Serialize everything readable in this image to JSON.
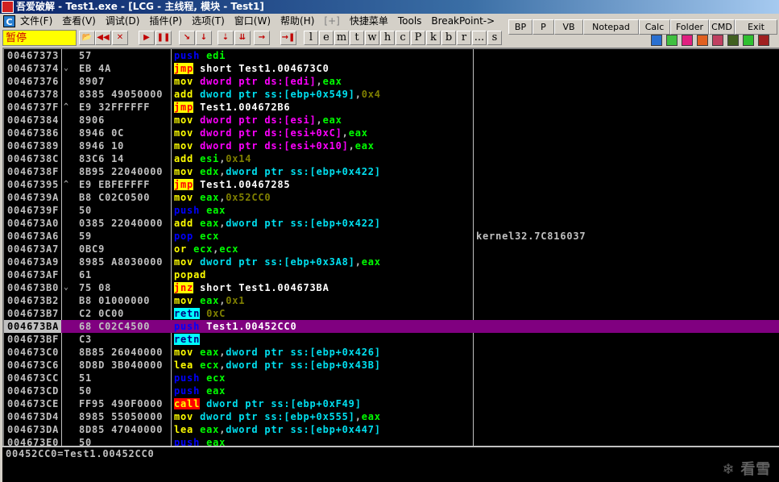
{
  "title": "吾爱破解 - Test1.exe - [LCG - 主线程, 模块 - Test1]",
  "menu": [
    "文件(F)",
    "查看(V)",
    "调试(D)",
    "插件(P)",
    "选项(T)",
    "窗口(W)",
    "帮助(H)",
    "[+]",
    "快捷菜单",
    "Tools",
    "BreakPoint->"
  ],
  "status": "暂停",
  "toolbar": {
    "icon_buttons": [
      "open-icon",
      "rewind-icon",
      "close-icon",
      "run-icon",
      "pause-icon",
      "step-into-icon",
      "step-over-icon",
      "trace-into-icon",
      "trace-over-icon",
      "execute-till-return-icon",
      "go-to-icon"
    ],
    "letter_buttons": [
      "l",
      "e",
      "m",
      "t",
      "w",
      "h",
      "c",
      "P",
      "k",
      "b",
      "r",
      "...",
      "s"
    ],
    "right_buttons": [
      "BP",
      "P",
      "VB",
      "Notepad",
      "Calc",
      "Folder",
      "CMD",
      "Exit"
    ]
  },
  "rows": [
    {
      "addr": "00467373",
      "mark": "",
      "hex": "57",
      "dis": [
        [
          "push",
          "push"
        ],
        [
          " ",
          "p"
        ],
        [
          "edi",
          "reg"
        ]
      ]
    },
    {
      "addr": "00467374",
      "mark": "⌄",
      "hex": "EB 4A",
      "dis": [
        [
          "jmp",
          "jmp"
        ],
        [
          " short Test1.004673C0",
          "label"
        ]
      ]
    },
    {
      "addr": "00467376",
      "mark": "",
      "hex": "8907",
      "dis": [
        [
          "mov",
          "op"
        ],
        [
          " dword ptr ds:[edi]",
          "ds"
        ],
        [
          ",",
          "p"
        ],
        [
          "eax",
          "reg"
        ]
      ]
    },
    {
      "addr": "00467378",
      "mark": "",
      "hex": "8385 49050000",
      "dis": [
        [
          "add",
          "op"
        ],
        [
          " dword ptr ss:[ebp+0x549]",
          "ss"
        ],
        [
          ",",
          "p"
        ],
        [
          "0x4",
          "const"
        ]
      ]
    },
    {
      "addr": "0046737F",
      "mark": "^",
      "hex": "E9 32FFFFFF",
      "dis": [
        [
          "jmp",
          "jmp"
        ],
        [
          " Test1.004672B6",
          "label"
        ]
      ]
    },
    {
      "addr": "00467384",
      "mark": "",
      "hex": "8906",
      "dis": [
        [
          "mov",
          "op"
        ],
        [
          " dword ptr ds:[esi]",
          "ds"
        ],
        [
          ",",
          "p"
        ],
        [
          "eax",
          "reg"
        ]
      ]
    },
    {
      "addr": "00467386",
      "mark": "",
      "hex": "8946 0C",
      "dis": [
        [
          "mov",
          "op"
        ],
        [
          " dword ptr ds:[esi+0xC]",
          "ds"
        ],
        [
          ",",
          "p"
        ],
        [
          "eax",
          "reg"
        ]
      ]
    },
    {
      "addr": "00467389",
      "mark": "",
      "hex": "8946 10",
      "dis": [
        [
          "mov",
          "op"
        ],
        [
          " dword ptr ds:[esi+0x10]",
          "ds"
        ],
        [
          ",",
          "p"
        ],
        [
          "eax",
          "reg"
        ]
      ]
    },
    {
      "addr": "0046738C",
      "mark": "",
      "hex": "83C6 14",
      "dis": [
        [
          "add",
          "op"
        ],
        [
          " esi",
          "reg"
        ],
        [
          ",",
          "p"
        ],
        [
          "0x14",
          "const"
        ]
      ]
    },
    {
      "addr": "0046738F",
      "mark": "",
      "hex": "8B95 22040000",
      "dis": [
        [
          "mov",
          "op"
        ],
        [
          " edx",
          "reg"
        ],
        [
          ",",
          "p"
        ],
        [
          "dword ptr ss:[ebp+0x422]",
          "ss"
        ]
      ]
    },
    {
      "addr": "00467395",
      "mark": "^",
      "hex": "E9 EBFEFFFF",
      "dis": [
        [
          "jmp",
          "jmp"
        ],
        [
          " Test1.00467285",
          "label"
        ]
      ]
    },
    {
      "addr": "0046739A",
      "mark": "",
      "hex": "B8 C02C0500",
      "dis": [
        [
          "mov",
          "op"
        ],
        [
          " eax",
          "reg"
        ],
        [
          ",",
          "p"
        ],
        [
          "0x52CC0",
          "const"
        ]
      ]
    },
    {
      "addr": "0046739F",
      "mark": "",
      "hex": "50",
      "dis": [
        [
          "push",
          "push"
        ],
        [
          " eax",
          "reg"
        ]
      ]
    },
    {
      "addr": "004673A0",
      "mark": "",
      "hex": "0385 22040000",
      "dis": [
        [
          "add",
          "op"
        ],
        [
          " eax",
          "reg"
        ],
        [
          ",",
          "p"
        ],
        [
          "dword ptr ss:[ebp+0x422]",
          "ss"
        ]
      ]
    },
    {
      "addr": "004673A6",
      "mark": "",
      "hex": "59",
      "dis": [
        [
          "pop",
          "push"
        ],
        [
          " ecx",
          "reg"
        ]
      ],
      "comment": "kernel32.7C816037"
    },
    {
      "addr": "004673A7",
      "mark": "",
      "hex": "0BC9",
      "dis": [
        [
          "or",
          "op"
        ],
        [
          " ecx",
          "reg"
        ],
        [
          ",",
          "p"
        ],
        [
          "ecx",
          "reg"
        ]
      ]
    },
    {
      "addr": "004673A9",
      "mark": "",
      "hex": "8985 A8030000",
      "dis": [
        [
          "mov",
          "op"
        ],
        [
          " dword ptr ss:[ebp+0x3A8]",
          "ss"
        ],
        [
          ",",
          "p"
        ],
        [
          "eax",
          "reg"
        ]
      ]
    },
    {
      "addr": "004673AF",
      "mark": "",
      "hex": "61",
      "dis": [
        [
          "popad",
          "op"
        ]
      ]
    },
    {
      "addr": "004673B0",
      "mark": "⌄",
      "hex": "75 08",
      "dis": [
        [
          "jnz",
          "jmp"
        ],
        [
          " short Test1.004673BA",
          "label"
        ]
      ]
    },
    {
      "addr": "004673B2",
      "mark": "",
      "hex": "B8 01000000",
      "dis": [
        [
          "mov",
          "op"
        ],
        [
          " eax",
          "reg"
        ],
        [
          ",",
          "p"
        ],
        [
          "0x1",
          "const"
        ]
      ]
    },
    {
      "addr": "004673B7",
      "mark": "",
      "hex": "C2 0C00",
      "dis": [
        [
          "retn",
          "retn"
        ],
        [
          " 0xC",
          "const"
        ]
      ]
    },
    {
      "addr": "004673BA",
      "mark": "",
      "hex": "68 C02C4500",
      "dis": [
        [
          "push",
          "push"
        ],
        [
          " Test1.00452CC0",
          "label"
        ]
      ],
      "selected": true
    },
    {
      "addr": "004673BF",
      "mark": "",
      "hex": "C3",
      "dis": [
        [
          "retn",
          "retn"
        ]
      ]
    },
    {
      "addr": "004673C0",
      "mark": "",
      "hex": "8B85 26040000",
      "dis": [
        [
          "mov",
          "op"
        ],
        [
          " eax",
          "reg"
        ],
        [
          ",",
          "p"
        ],
        [
          "dword ptr ss:[ebp+0x426]",
          "ss"
        ]
      ]
    },
    {
      "addr": "004673C6",
      "mark": "",
      "hex": "8D8D 3B040000",
      "dis": [
        [
          "lea",
          "op"
        ],
        [
          " ecx",
          "reg"
        ],
        [
          ",",
          "p"
        ],
        [
          "dword ptr ss:[ebp+0x43B]",
          "ss"
        ]
      ]
    },
    {
      "addr": "004673CC",
      "mark": "",
      "hex": "51",
      "dis": [
        [
          "push",
          "push"
        ],
        [
          " ecx",
          "reg"
        ]
      ]
    },
    {
      "addr": "004673CD",
      "mark": "",
      "hex": "50",
      "dis": [
        [
          "push",
          "push"
        ],
        [
          " eax",
          "reg"
        ]
      ]
    },
    {
      "addr": "004673CE",
      "mark": "",
      "hex": "FF95 490F0000",
      "dis": [
        [
          "call",
          "call"
        ],
        [
          " dword ptr ss:[ebp+0xF49]",
          "ss"
        ]
      ]
    },
    {
      "addr": "004673D4",
      "mark": "",
      "hex": "8985 55050000",
      "dis": [
        [
          "mov",
          "op"
        ],
        [
          " dword ptr ss:[ebp+0x555]",
          "ss"
        ],
        [
          ",",
          "p"
        ],
        [
          "eax",
          "reg"
        ]
      ]
    },
    {
      "addr": "004673DA",
      "mark": "",
      "hex": "8D85 47040000",
      "dis": [
        [
          "lea",
          "op"
        ],
        [
          " eax",
          "reg"
        ],
        [
          ",",
          "p"
        ],
        [
          "dword ptr ss:[ebp+0x447]",
          "ss"
        ]
      ]
    },
    {
      "addr": "004673E0",
      "mark": "",
      "hex": "50",
      "dis": [
        [
          "push",
          "push"
        ],
        [
          " eax",
          "reg"
        ]
      ]
    }
  ],
  "info": "00452CC0=Test1.00452CC0",
  "watermark": "看雪",
  "colors": {
    "selection": "#800080",
    "status_bg": "#ffff00",
    "titlebar": "#0a246a"
  }
}
